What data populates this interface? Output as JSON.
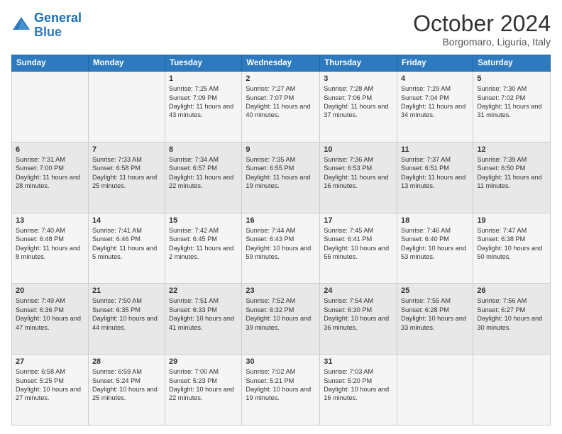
{
  "header": {
    "logo_line1": "General",
    "logo_line2": "Blue",
    "month": "October 2024",
    "location": "Borgomaro, Liguria, Italy"
  },
  "weekdays": [
    "Sunday",
    "Monday",
    "Tuesday",
    "Wednesday",
    "Thursday",
    "Friday",
    "Saturday"
  ],
  "weeks": [
    [
      {
        "day": "",
        "sunrise": "",
        "sunset": "",
        "daylight": ""
      },
      {
        "day": "",
        "sunrise": "",
        "sunset": "",
        "daylight": ""
      },
      {
        "day": "1",
        "sunrise": "Sunrise: 7:25 AM",
        "sunset": "Sunset: 7:09 PM",
        "daylight": "Daylight: 11 hours and 43 minutes."
      },
      {
        "day": "2",
        "sunrise": "Sunrise: 7:27 AM",
        "sunset": "Sunset: 7:07 PM",
        "daylight": "Daylight: 11 hours and 40 minutes."
      },
      {
        "day": "3",
        "sunrise": "Sunrise: 7:28 AM",
        "sunset": "Sunset: 7:06 PM",
        "daylight": "Daylight: 11 hours and 37 minutes."
      },
      {
        "day": "4",
        "sunrise": "Sunrise: 7:29 AM",
        "sunset": "Sunset: 7:04 PM",
        "daylight": "Daylight: 11 hours and 34 minutes."
      },
      {
        "day": "5",
        "sunrise": "Sunrise: 7:30 AM",
        "sunset": "Sunset: 7:02 PM",
        "daylight": "Daylight: 11 hours and 31 minutes."
      }
    ],
    [
      {
        "day": "6",
        "sunrise": "Sunrise: 7:31 AM",
        "sunset": "Sunset: 7:00 PM",
        "daylight": "Daylight: 11 hours and 28 minutes."
      },
      {
        "day": "7",
        "sunrise": "Sunrise: 7:33 AM",
        "sunset": "Sunset: 6:58 PM",
        "daylight": "Daylight: 11 hours and 25 minutes."
      },
      {
        "day": "8",
        "sunrise": "Sunrise: 7:34 AM",
        "sunset": "Sunset: 6:57 PM",
        "daylight": "Daylight: 11 hours and 22 minutes."
      },
      {
        "day": "9",
        "sunrise": "Sunrise: 7:35 AM",
        "sunset": "Sunset: 6:55 PM",
        "daylight": "Daylight: 11 hours and 19 minutes."
      },
      {
        "day": "10",
        "sunrise": "Sunrise: 7:36 AM",
        "sunset": "Sunset: 6:53 PM",
        "daylight": "Daylight: 11 hours and 16 minutes."
      },
      {
        "day": "11",
        "sunrise": "Sunrise: 7:37 AM",
        "sunset": "Sunset: 6:51 PM",
        "daylight": "Daylight: 11 hours and 13 minutes."
      },
      {
        "day": "12",
        "sunrise": "Sunrise: 7:39 AM",
        "sunset": "Sunset: 6:50 PM",
        "daylight": "Daylight: 11 hours and 11 minutes."
      }
    ],
    [
      {
        "day": "13",
        "sunrise": "Sunrise: 7:40 AM",
        "sunset": "Sunset: 6:48 PM",
        "daylight": "Daylight: 11 hours and 8 minutes."
      },
      {
        "day": "14",
        "sunrise": "Sunrise: 7:41 AM",
        "sunset": "Sunset: 6:46 PM",
        "daylight": "Daylight: 11 hours and 5 minutes."
      },
      {
        "day": "15",
        "sunrise": "Sunrise: 7:42 AM",
        "sunset": "Sunset: 6:45 PM",
        "daylight": "Daylight: 11 hours and 2 minutes."
      },
      {
        "day": "16",
        "sunrise": "Sunrise: 7:44 AM",
        "sunset": "Sunset: 6:43 PM",
        "daylight": "Daylight: 10 hours and 59 minutes."
      },
      {
        "day": "17",
        "sunrise": "Sunrise: 7:45 AM",
        "sunset": "Sunset: 6:41 PM",
        "daylight": "Daylight: 10 hours and 56 minutes."
      },
      {
        "day": "18",
        "sunrise": "Sunrise: 7:46 AM",
        "sunset": "Sunset: 6:40 PM",
        "daylight": "Daylight: 10 hours and 53 minutes."
      },
      {
        "day": "19",
        "sunrise": "Sunrise: 7:47 AM",
        "sunset": "Sunset: 6:38 PM",
        "daylight": "Daylight: 10 hours and 50 minutes."
      }
    ],
    [
      {
        "day": "20",
        "sunrise": "Sunrise: 7:49 AM",
        "sunset": "Sunset: 6:36 PM",
        "daylight": "Daylight: 10 hours and 47 minutes."
      },
      {
        "day": "21",
        "sunrise": "Sunrise: 7:50 AM",
        "sunset": "Sunset: 6:35 PM",
        "daylight": "Daylight: 10 hours and 44 minutes."
      },
      {
        "day": "22",
        "sunrise": "Sunrise: 7:51 AM",
        "sunset": "Sunset: 6:33 PM",
        "daylight": "Daylight: 10 hours and 41 minutes."
      },
      {
        "day": "23",
        "sunrise": "Sunrise: 7:52 AM",
        "sunset": "Sunset: 6:32 PM",
        "daylight": "Daylight: 10 hours and 39 minutes."
      },
      {
        "day": "24",
        "sunrise": "Sunrise: 7:54 AM",
        "sunset": "Sunset: 6:30 PM",
        "daylight": "Daylight: 10 hours and 36 minutes."
      },
      {
        "day": "25",
        "sunrise": "Sunrise: 7:55 AM",
        "sunset": "Sunset: 6:28 PM",
        "daylight": "Daylight: 10 hours and 33 minutes."
      },
      {
        "day": "26",
        "sunrise": "Sunrise: 7:56 AM",
        "sunset": "Sunset: 6:27 PM",
        "daylight": "Daylight: 10 hours and 30 minutes."
      }
    ],
    [
      {
        "day": "27",
        "sunrise": "Sunrise: 6:58 AM",
        "sunset": "Sunset: 5:25 PM",
        "daylight": "Daylight: 10 hours and 27 minutes."
      },
      {
        "day": "28",
        "sunrise": "Sunrise: 6:59 AM",
        "sunset": "Sunset: 5:24 PM",
        "daylight": "Daylight: 10 hours and 25 minutes."
      },
      {
        "day": "29",
        "sunrise": "Sunrise: 7:00 AM",
        "sunset": "Sunset: 5:23 PM",
        "daylight": "Daylight: 10 hours and 22 minutes."
      },
      {
        "day": "30",
        "sunrise": "Sunrise: 7:02 AM",
        "sunset": "Sunset: 5:21 PM",
        "daylight": "Daylight: 10 hours and 19 minutes."
      },
      {
        "day": "31",
        "sunrise": "Sunrise: 7:03 AM",
        "sunset": "Sunset: 5:20 PM",
        "daylight": "Daylight: 10 hours and 16 minutes."
      },
      {
        "day": "",
        "sunrise": "",
        "sunset": "",
        "daylight": ""
      },
      {
        "day": "",
        "sunrise": "",
        "sunset": "",
        "daylight": ""
      }
    ]
  ]
}
